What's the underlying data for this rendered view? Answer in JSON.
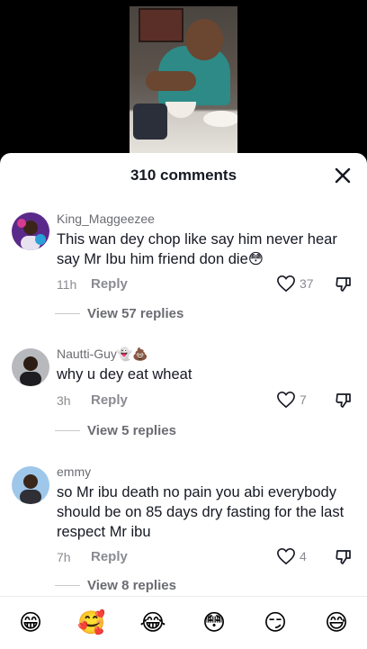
{
  "sheet": {
    "title": "310 comments"
  },
  "comments": [
    {
      "username": "King_Maggeezee",
      "text": "This wan dey chop like say him never hear say Mr Ibu him friend don die😳",
      "time": "11h",
      "reply_label": "Reply",
      "likes": "37",
      "view_replies": "View 57 replies"
    },
    {
      "username": "Nautti-Guy👻💩",
      "text": "why u dey eat wheat",
      "time": "3h",
      "reply_label": "Reply",
      "likes": "7",
      "view_replies": "View 5 replies"
    },
    {
      "username": "emmy",
      "text": "so Mr ibu death no pain you abi everybody should be on 85 days dry fasting for the last respect Mr ibu",
      "time": "7h",
      "reply_label": "Reply",
      "likes": "4",
      "view_replies": "View 8 replies"
    }
  ],
  "emoji_bar": [
    "😁",
    "🥰",
    "😂",
    "😳",
    "😏",
    "😅"
  ],
  "icons": {
    "close": "close-icon",
    "like": "heart-outline-icon",
    "dislike": "thumbs-down-icon"
  }
}
